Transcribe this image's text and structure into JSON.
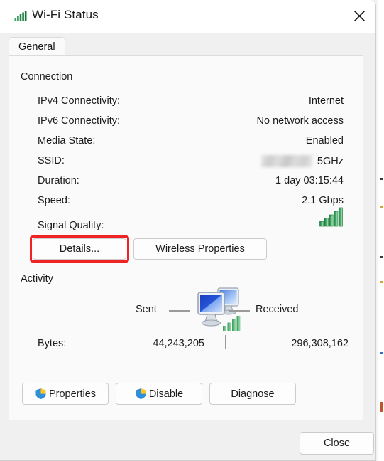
{
  "window": {
    "title": "Wi-Fi Status",
    "title_icon": "wifi-signal-icon",
    "close_icon": "close-icon"
  },
  "tabs": [
    {
      "label": "General",
      "selected": true
    }
  ],
  "connection": {
    "group_title": "Connection",
    "rows": [
      {
        "label": "IPv4 Connectivity:",
        "value": "Internet"
      },
      {
        "label": "IPv6 Connectivity:",
        "value": "No network access"
      },
      {
        "label": "Media State:",
        "value": "Enabled"
      },
      {
        "label": "SSID:",
        "value": "5GHz",
        "redacted": true
      },
      {
        "label": "Duration:",
        "value": "1 day 03:15:44"
      },
      {
        "label": "Speed:",
        "value": "2.1 Gbps"
      }
    ],
    "signal_quality": {
      "label": "Signal Quality:",
      "icon": "signal-bars-icon",
      "bars_total": 5,
      "bars_filled": 5,
      "color": "#2e9e4f"
    },
    "buttons": [
      {
        "label": "Details...",
        "highlighted": true
      },
      {
        "label": "Wireless Properties",
        "highlighted": false
      }
    ]
  },
  "activity": {
    "group_title": "Activity",
    "sent_label": "Sent",
    "received_label": "Received",
    "center_icon": "network-computers-icon",
    "bytes_label": "Bytes:",
    "bytes_sent": "44,243,205",
    "bytes_received": "296,308,162"
  },
  "footer": {
    "buttons": [
      {
        "label": "Properties",
        "icon": "uac-shield-icon"
      },
      {
        "label": "Disable",
        "icon": "uac-shield-icon"
      },
      {
        "label": "Diagnose",
        "icon": null
      }
    ],
    "close_label": "Close"
  },
  "colors": {
    "accent_green": "#2e9e4f",
    "annotation_red": "#ef2323",
    "shield_blue": "#2f8fd8",
    "shield_yellow": "#ffc425",
    "monitor_blue": "#1f3fb5"
  }
}
